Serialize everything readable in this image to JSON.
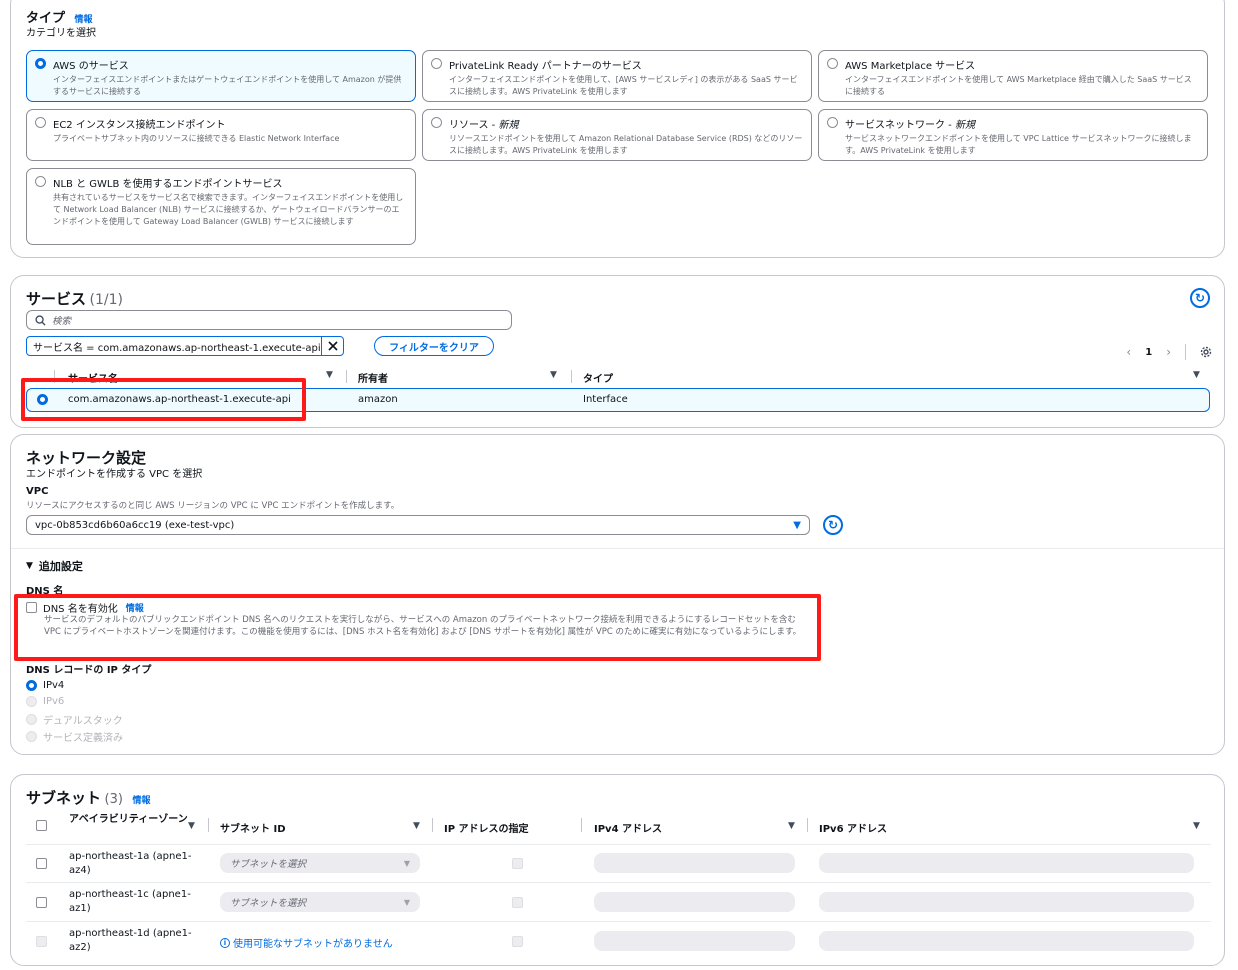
{
  "type_section": {
    "title": "タイプ",
    "info": "情報",
    "subtitle": "カテゴリを選択",
    "tiles": [
      {
        "title": "AWS のサービス",
        "desc": "インターフェイスエンドポイントまたはゲートウェイエンドポイントを使用して Amazon が提供するサービスに接続する"
      },
      {
        "title": "PrivateLink Ready パートナーのサービス",
        "desc": "インターフェイスエンドポイントを使用して、[AWS サービスレディ] の表示がある SaaS サービスに接続します。AWS PrivateLink を使用します"
      },
      {
        "title": "AWS Marketplace サービス",
        "desc": "インターフェイスエンドポイントを使用して AWS Marketplace 経由で購入した SaaS サービスに接続する"
      },
      {
        "title": "EC2 インスタンス接続エンドポイント",
        "desc": "プライベートサブネット内のリソースに接続できる Elastic Network Interface"
      },
      {
        "title": "リソース - ",
        "title_new": "新規",
        "desc": "リソースエンドポイントを使用して Amazon Relational Database Service (RDS) などのリソースに接続します。AWS PrivateLink を使用します"
      },
      {
        "title": "サービスネットワーク - ",
        "title_new": "新規",
        "desc": "サービスネットワークエンドポイントを使用して VPC Lattice サービスネットワークに接続します。AWS PrivateLink を使用します"
      },
      {
        "title": "NLB と GWLB を使用するエンドポイントサービス",
        "desc": "共有されているサービスをサービス名で検索できます。インターフェイスエンドポイントを使用して Network Load Balancer (NLB) サービスに接続するか、ゲートウェイロードバランサーのエンドポイントを使用して Gateway Load Balancer (GWLB) サービスに接続します"
      }
    ]
  },
  "services": {
    "title": "サービス",
    "count": "(1/1)",
    "search_placeholder": "検索",
    "filter_token": "サービス名 = com.amazonaws.ap-northeast-1.execute-api",
    "clear_filter": "フィルターをクリア",
    "page": "1",
    "columns": [
      "サービス名",
      "所有者",
      "タイプ"
    ],
    "rows": [
      {
        "name": "com.amazonaws.ap-northeast-1.execute-api",
        "owner": "amazon",
        "type": "Interface"
      }
    ]
  },
  "network": {
    "title": "ネットワーク設定",
    "subtitle": "エンドポイントを作成する VPC を選択",
    "vpc_label": "VPC",
    "vpc_desc": "リソースにアクセスするのと同じ AWS リージョンの VPC に VPC エンドポイントを作成します。",
    "vpc_value": "vpc-0b853cd6b60a6cc19 (exe-test-vpc)",
    "additional": "追加設定",
    "dns_name_label": "DNS 名",
    "dns_enable": "DNS 名を有効化",
    "dns_info": "情報",
    "dns_desc": "サービスのデフォルトのパブリックエンドポイント DNS 名へのリクエストを実行しながら、サービスへの Amazon のプライベートネットワーク接続を利用できるようにするレコードセットを含む VPC にプライベートホストゾーンを関連付けます。この機能を使用するには、[DNS ホスト名を有効化] および [DNS サポートを有効化] 属性が VPC のために確実に有効になっているようにします。",
    "ip_type_label": "DNS レコードの IP タイプ",
    "ip_options": [
      "IPv4",
      "IPv6",
      "デュアルスタック",
      "サービス定義済み"
    ]
  },
  "subnets": {
    "title": "サブネット",
    "count": "(3)",
    "info": "情報",
    "columns": [
      "アベイラビリティーゾーン",
      "サブネット ID",
      "IP アドレスの指定",
      "IPv4 アドレス",
      "IPv6 アドレス"
    ],
    "rows": [
      {
        "az1": "ap-northeast-1a (apne1-",
        "az2": "az4)",
        "subnet": "サブネットを選択"
      },
      {
        "az1": "ap-northeast-1c (apne1-",
        "az2": "az1)",
        "subnet": "サブネットを選択"
      },
      {
        "az1": "ap-northeast-1d (apne1-",
        "az2": "az2)",
        "subnet_none": "使用可能なサブネットがありません"
      }
    ]
  },
  "colors": {
    "accent": "#006ce0",
    "highlight": "#ff1a1a",
    "border": "#c6c6cd"
  }
}
